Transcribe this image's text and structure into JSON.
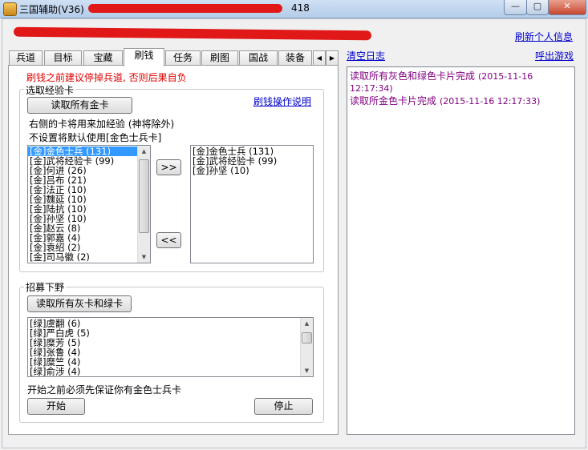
{
  "window": {
    "title": "三国辅助(V36)",
    "title_suffix": "418",
    "controls": [
      "minimize",
      "maximize",
      "close"
    ]
  },
  "header": {
    "refresh_profile_link": "刷新个人信息",
    "clear_log_link": "清空日志",
    "show_game_link": "呼出游戏"
  },
  "tabs": [
    {
      "label": "兵道",
      "active": false
    },
    {
      "label": "目标",
      "active": false
    },
    {
      "label": "宝藏",
      "active": false
    },
    {
      "label": "刷钱",
      "active": true
    },
    {
      "label": "任务",
      "active": false
    },
    {
      "label": "刷图",
      "active": false
    },
    {
      "label": "国战",
      "active": false
    },
    {
      "label": "装备",
      "active": false
    }
  ],
  "tab_scroll": {
    "left": "◀",
    "right": "▶"
  },
  "panel": {
    "warning": "刷钱之前建议停掉兵道, 否则后果自负",
    "warning_color": "#e00000",
    "exp_group": {
      "title": "选取经验卡",
      "read_gold_button": "读取所有金卡",
      "help_link": "刷钱操作说明",
      "note1": "右侧的卡将用来加经验 (神将除外)",
      "note2": "不设置将默认使用[金色士兵卡]",
      "add_button": ">>",
      "remove_button": "<<",
      "left_list": [
        "[金]金色士兵 (131)",
        "[金]武将经验卡 (99)",
        "[金]何进 (26)",
        "[金]吕布 (21)",
        "[金]法正 (10)",
        "[金]魏延 (10)",
        "[金]陆抗 (10)",
        "[金]孙坚 (10)",
        "[金]赵云 (8)",
        "[金]郭嘉 (4)",
        "[金]袁绍 (2)",
        "[金]司马徽 (2)"
      ],
      "right_list": [
        "[金]金色士兵 (131)",
        "[金]武将经验卡 (99)",
        "[金]孙坚 (10)"
      ]
    },
    "recruit_group": {
      "title": "招募下野",
      "read_button": "读取所有灰卡和绿卡",
      "list": [
        "[绿]虞翻 (6)",
        "[绿]严白虎 (5)",
        "[绿]糜芳 (5)",
        "[绿]张鲁 (4)",
        "[绿]糜竺 (4)",
        "[绿]俞涉 (4)"
      ]
    },
    "footer_note": "开始之前必须先保证你有金色士兵卡",
    "start_button": "开始",
    "stop_button": "停止"
  },
  "log": {
    "color": "#800080",
    "entries": [
      {
        "text": "读取所有灰色和绿色卡片完成",
        "time": "(2015-11-16",
        "time2": "12:17:34)"
      },
      {
        "text": "读取所金色卡片完成",
        "time": "(2015-11-16 12:17:33)"
      }
    ]
  }
}
